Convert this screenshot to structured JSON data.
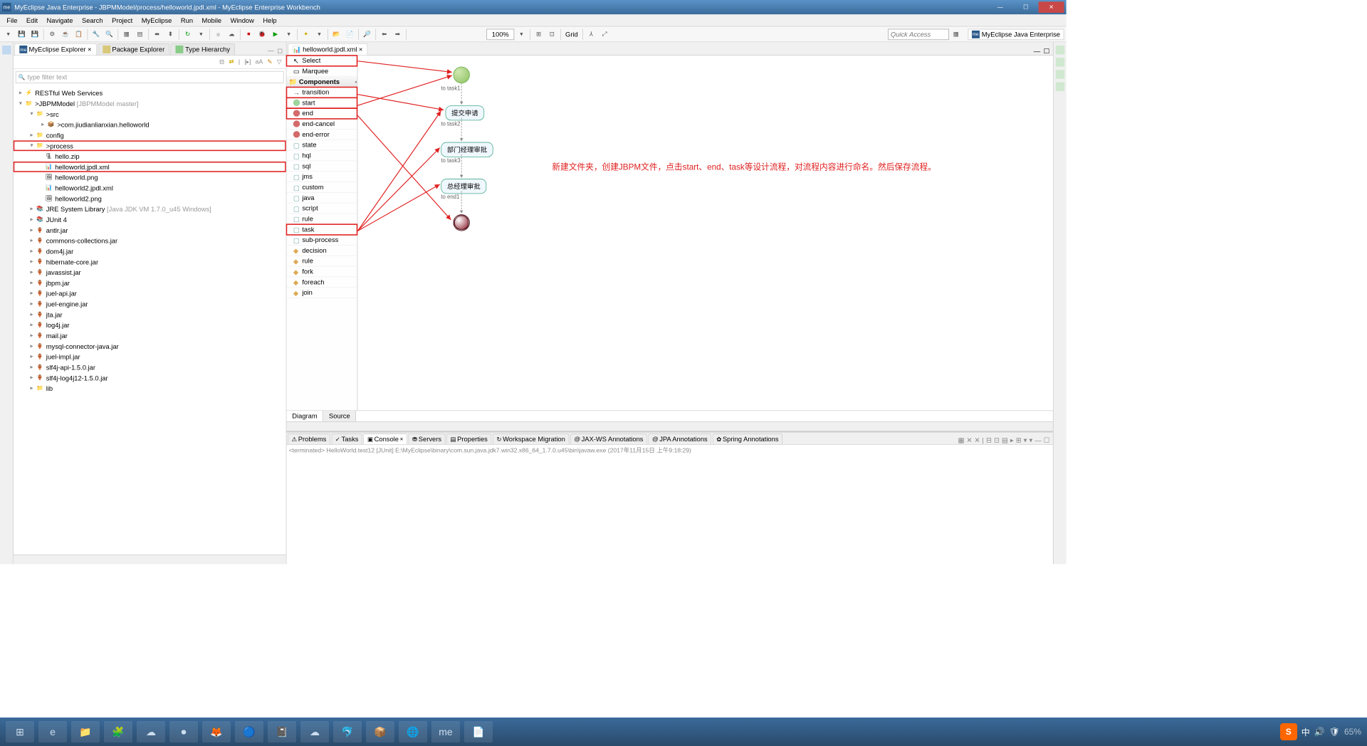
{
  "title": "MyEclipse Java Enterprise - JBPMModel/process/helloworld.jpdl.xml - MyEclipse Enterprise Workbench",
  "menu": [
    "File",
    "Edit",
    "Navigate",
    "Search",
    "Project",
    "MyEclipse",
    "Run",
    "Mobile",
    "Window",
    "Help"
  ],
  "quick_access": "Quick Access",
  "perspective": "MyEclipse Java Enterprise",
  "zoom": "100%",
  "grid": "Grid",
  "left_tabs": {
    "t1": "MyEclipse Explorer",
    "t2": "Package Explorer",
    "t3": "Type Hierarchy"
  },
  "filter_placeholder": "type filter text",
  "tree": {
    "rest": "RESTful Web Services",
    "proj": "JBPMModel",
    "proj_deco": "[JBPMModel master]",
    "src": "src",
    "pkg": "com.jiudianlianxian.helloworld",
    "config": "config",
    "process": "process",
    "f_zip": "hello.zip",
    "f_jpdl": "helloworld.jpdl.xml",
    "f_png": "helloworld.png",
    "f_jpdl2": "helloworld2.jpdl.xml",
    "f_png2": "helloworld2.png",
    "jre": "JRE System Library",
    "jre_deco": "[Java JDK VM 1.7.0_u45 Windows]",
    "junit": "JUnit 4",
    "jars": [
      "antlr.jar",
      "commons-collections.jar",
      "dom4j.jar",
      "hibernate-core.jar",
      "javassist.jar",
      "jbpm.jar",
      "juel-api.jar",
      "juel-engine.jar",
      "jta.jar",
      "log4j.jar",
      "mail.jar",
      "mysql-connector-java.jar",
      "juel-impl.jar",
      "slf4j-api-1.5.0.jar",
      "slf4j-log4j12-1.5.0.jar"
    ],
    "lib": "lib"
  },
  "editor_tab": "helloworld.jpdl.xml",
  "palette": {
    "select": "Select",
    "marquee": "Marquee",
    "components": "Components",
    "transition": "transition",
    "start": "start",
    "end": "end",
    "endcancel": "end-cancel",
    "enderror": "end-error",
    "state": "state",
    "hql": "hql",
    "sql": "sql",
    "jms": "jms",
    "custom": "custom",
    "java": "java",
    "script": "script",
    "rule": "rule",
    "task": "task",
    "subprocess": "sub-process",
    "decision": "decision",
    "rule2": "rule",
    "fork": "fork",
    "foreach": "foreach",
    "join": "join"
  },
  "nodes": {
    "n1": "提交申请",
    "n2": "部门经理审批",
    "n3": "总经理审批"
  },
  "arrows": {
    "a1": "to task1",
    "a2": "to task2",
    "a3": "to task3",
    "a4": "to end1"
  },
  "annotation": "新建文件夹，创建JBPM文件，点击start、end、task等设计流程，对流程内容进行命名。然后保存流程。",
  "bottom": {
    "diagram": "Diagram",
    "source": "Source"
  },
  "console_tabs": [
    "Problems",
    "Tasks",
    "Console",
    "Servers",
    "Properties",
    "Workspace Migration",
    "JAX-WS Annotations",
    "JPA Annotations",
    "Spring Annotations"
  ],
  "console_line": "<terminated> HelloWorld.test12 [JUnit] E:\\MyEclipse\\binary\\com.sun.java.jdk7.win32.x86_64_1.7.0.u45\\bin\\javaw.exe (2017年11月15日 上午9:18:29)",
  "tray": {
    "ime": "中",
    "pct": "65%",
    "time": "",
    "date": ""
  }
}
